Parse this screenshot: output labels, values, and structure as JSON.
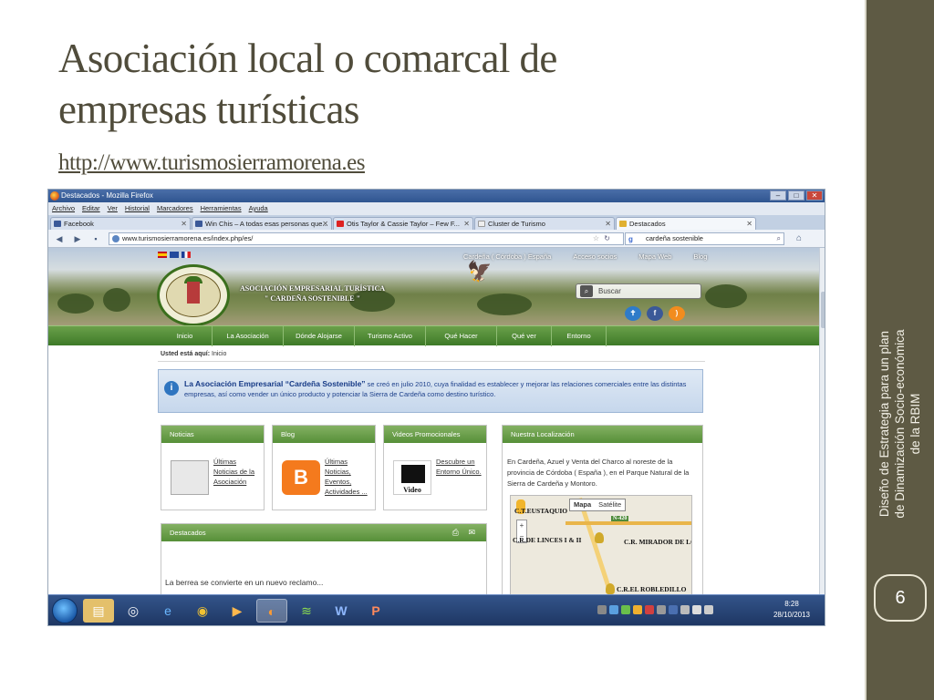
{
  "slide": {
    "title_line1": "Asociación local o comarcal de",
    "title_line2": "empresas turísticas",
    "link": "http://www.turismosierramorena.es",
    "sidebar_text_line1": "Diseño de Estrategia  para un plan",
    "sidebar_text_line2": "de Dinamización Socio-económica",
    "sidebar_text_line3": "de la RBIM",
    "page_number": "6"
  },
  "browser": {
    "window_title": "Destacados - Mozilla Firefox",
    "menu": [
      "Archivo",
      "Editar",
      "Ver",
      "Historial",
      "Marcadores",
      "Herramientas",
      "Ayuda"
    ],
    "tabs": [
      {
        "label": "Facebook",
        "color": "#3b5998"
      },
      {
        "label": "Win Chis – A todas esas personas que...",
        "color": "#3b5998"
      },
      {
        "label": "Otis Taylor & Cassie Taylor – Few F...",
        "color": "#d22"
      },
      {
        "label": "Cluster de Turismo",
        "color": "#eeeeee"
      },
      {
        "label": "Destacados",
        "color": "#e0b030"
      }
    ],
    "url": "www.turismosierramorena.es/index.php/es/",
    "search_value": "cardeña sostenible",
    "search_engine": "g",
    "icons": {
      "back": "back-arrow-icon",
      "forward": "forward-arrow-icon",
      "home": "home-icon",
      "star": "bookmark-star-icon",
      "reload": "reload-icon"
    }
  },
  "site": {
    "top_links": [
      "Cardeña ( Córdoba ) España",
      "Acceso socios",
      "Mapa Web",
      "Blog"
    ],
    "logo_circle": "CARDEÑA SOSTENIBLE",
    "logo_line1": "ASOCIACIÓN EMPRESARIAL TURÍSTICA",
    "logo_line2": "\" CARDEÑA SOSTENIBLE \"",
    "search_placeholder": "Buscar",
    "nav": [
      "Inicio",
      "La Asociación",
      "Dónde Alojarse",
      "Turismo Activo",
      "Qué Hacer",
      "Qué ver",
      "Entorno"
    ],
    "breadcrumb_label": "Usted está aquí:",
    "breadcrumb_value": "Inicio",
    "info_bold": "La Asociación Empresarial “Cardeña Sostenible”",
    "info_text": " se creó en julio 2010, cuya finalidad es establecer y mejorar las relaciones comerciales entre las distintas empresas, así como vender un único producto y potenciar la Sierra de Cardeña como destino turístico.",
    "panels": {
      "noticias": {
        "title": "Noticias",
        "link": "Últimas Noticias de la Asociación",
        "link_lines": [
          "Últimas",
          "Noticias de la",
          "Asociación"
        ]
      },
      "blog": {
        "title": "Blog",
        "link_lines": [
          "Últimas",
          "Noticias,",
          "Eventos,",
          "Actividades ..."
        ]
      },
      "videos": {
        "title": "Videos Promocionales",
        "link_lines": [
          "Descubre un",
          "Entorno Único."
        ],
        "icon_label": "Video"
      },
      "localizacion": {
        "title": "Nuestra Localización",
        "text": "En Cardeña, Azuel y Venta del Charco al noreste de la provincia de Córdoba ( España ), en el Parque Natural de la Sierra de Cardeña y Montoro.",
        "map_tabs": [
          "Mapa",
          "Satélite"
        ],
        "map_labels": [
          "C.T.EUSTAQUIO",
          "C.R.DE LINCES I & II",
          "C.R. MIRADOR DE LOS I",
          "C.R.EL ROBLEDILLO"
        ],
        "road_label": "N-420"
      },
      "destacados": {
        "title": "Destacados",
        "caption": "La berrea se convierte en un nuevo reclamo..."
      }
    }
  },
  "taskbar": {
    "time": "8:28",
    "date": "28/10/2013",
    "apps": [
      "explorer-icon",
      "chrome-alt-icon",
      "ie-icon",
      "chrome-icon",
      "media-player-icon",
      "firefox-icon",
      "spotify-icon",
      "word-icon",
      "powerpoint-icon"
    ]
  }
}
